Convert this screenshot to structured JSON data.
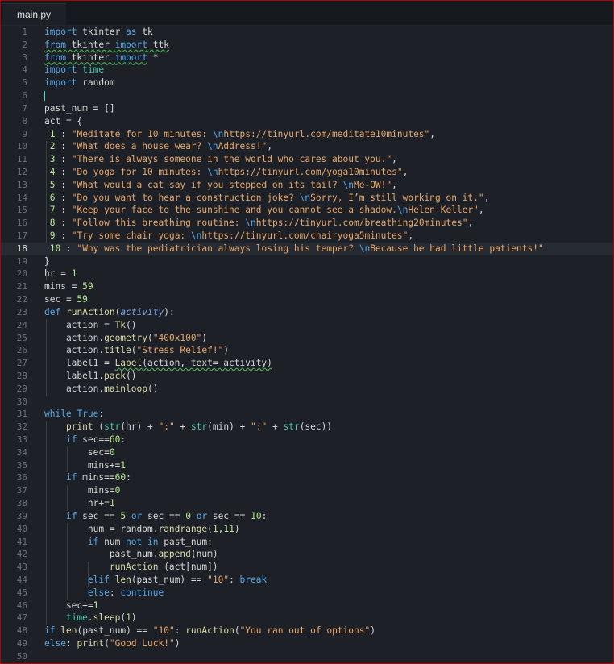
{
  "tab": {
    "filename": "main.py"
  },
  "lines": [
    {
      "n": "1",
      "segs": [
        [
          "kw",
          "import"
        ],
        [
          "op",
          " tkinter "
        ],
        [
          "kw",
          "as"
        ],
        [
          "op",
          " tk"
        ]
      ]
    },
    {
      "n": "2",
      "segs": [
        [
          "kw sq",
          "from"
        ],
        [
          "op sq",
          " tkinter "
        ],
        [
          "kw sq",
          "import"
        ],
        [
          "op sq",
          " ttk"
        ]
      ]
    },
    {
      "n": "3",
      "segs": [
        [
          "kw sq",
          "from"
        ],
        [
          "op sq",
          " tkinter "
        ],
        [
          "kw sq",
          "import"
        ],
        [
          "op",
          " *"
        ]
      ]
    },
    {
      "n": "4",
      "segs": [
        [
          "kw",
          "import"
        ],
        [
          "op",
          " "
        ],
        [
          "bi",
          "time"
        ]
      ]
    },
    {
      "n": "5",
      "segs": [
        [
          "kw",
          "import"
        ],
        [
          "op",
          " random"
        ]
      ]
    },
    {
      "n": "6",
      "segs": [],
      "cursor": true
    },
    {
      "n": "7",
      "segs": [
        [
          "op",
          "past_num = []"
        ]
      ]
    },
    {
      "n": "8",
      "segs": [
        [
          "op",
          "act = {"
        ]
      ]
    },
    {
      "n": "9",
      "segs": [
        [
          "op",
          " "
        ],
        [
          "nm",
          "1"
        ],
        [
          "op",
          " : "
        ],
        [
          "st",
          "\"Meditate for 10 minutes: "
        ],
        [
          "kw",
          "\\n"
        ],
        [
          "st",
          "https://tinyurl.com/meditate10minutes\""
        ],
        [
          "op",
          ","
        ]
      ]
    },
    {
      "n": "10",
      "segs": [
        [
          "op",
          " "
        ],
        [
          "nm",
          "2"
        ],
        [
          "op",
          " : "
        ],
        [
          "st",
          "\"What does a house wear? "
        ],
        [
          "kw",
          "\\n"
        ],
        [
          "st",
          "Address!\""
        ],
        [
          "op",
          ","
        ]
      ]
    },
    {
      "n": "11",
      "segs": [
        [
          "op",
          " "
        ],
        [
          "nm",
          "3"
        ],
        [
          "op",
          " : "
        ],
        [
          "st",
          "\"There is always someone in the world who cares about you.\""
        ],
        [
          "op",
          ","
        ]
      ]
    },
    {
      "n": "12",
      "segs": [
        [
          "op",
          " "
        ],
        [
          "nm",
          "4"
        ],
        [
          "op",
          " : "
        ],
        [
          "st",
          "\"Do yoga for 10 minutes: "
        ],
        [
          "kw",
          "\\n"
        ],
        [
          "st",
          "https://tinyurl.com/yoga10minutes\""
        ],
        [
          "op",
          ","
        ]
      ]
    },
    {
      "n": "13",
      "segs": [
        [
          "op",
          " "
        ],
        [
          "nm",
          "5"
        ],
        [
          "op",
          " : "
        ],
        [
          "st",
          "\"What would a cat say if you stepped on its tail? "
        ],
        [
          "kw",
          "\\n"
        ],
        [
          "st",
          "Me-OW!\""
        ],
        [
          "op",
          ","
        ]
      ]
    },
    {
      "n": "14",
      "segs": [
        [
          "op",
          " "
        ],
        [
          "nm",
          "6"
        ],
        [
          "op",
          " : "
        ],
        [
          "st",
          "\"Do you want to hear a construction joke? "
        ],
        [
          "kw",
          "\\n"
        ],
        [
          "st",
          "Sorry, I’m still working on it.\""
        ],
        [
          "op",
          ","
        ]
      ]
    },
    {
      "n": "15",
      "segs": [
        [
          "op",
          " "
        ],
        [
          "nm",
          "7"
        ],
        [
          "op",
          " : "
        ],
        [
          "st",
          "\"Keep your face to the sunshine and you cannot see a shadow."
        ],
        [
          "kw",
          "\\n"
        ],
        [
          "st",
          "Helen Keller\""
        ],
        [
          "op",
          ","
        ]
      ]
    },
    {
      "n": "16",
      "segs": [
        [
          "op",
          " "
        ],
        [
          "nm",
          "8"
        ],
        [
          "op",
          " : "
        ],
        [
          "st",
          "\"Follow this breathing routine: "
        ],
        [
          "kw",
          "\\n"
        ],
        [
          "st",
          "https://tinyurl.com/breathing20minutes\""
        ],
        [
          "op",
          ","
        ]
      ]
    },
    {
      "n": "17",
      "segs": [
        [
          "op",
          " "
        ],
        [
          "nm",
          "9"
        ],
        [
          "op",
          " : "
        ],
        [
          "st",
          "\"Try some chair yoga: "
        ],
        [
          "kw",
          "\\n"
        ],
        [
          "st",
          "https://tinyurl.com/chairyoga5minutes\""
        ],
        [
          "op",
          ","
        ]
      ]
    },
    {
      "n": "18",
      "segs": [
        [
          "op",
          " "
        ],
        [
          "nm",
          "10"
        ],
        [
          "op",
          " : "
        ],
        [
          "st",
          "\"Why was the pediatrician always losing his temper? "
        ],
        [
          "kw",
          "\\n"
        ],
        [
          "st",
          "Because he had little patients!\""
        ]
      ],
      "active": true
    },
    {
      "n": "19",
      "segs": [
        [
          "op",
          "}"
        ]
      ]
    },
    {
      "n": "20",
      "segs": [
        [
          "op",
          "hr = "
        ],
        [
          "nm",
          "1"
        ]
      ]
    },
    {
      "n": "21",
      "segs": [
        [
          "op",
          "mins = "
        ],
        [
          "nm",
          "59"
        ]
      ]
    },
    {
      "n": "22",
      "segs": [
        [
          "op",
          "sec = "
        ],
        [
          "nm",
          "59"
        ]
      ]
    },
    {
      "n": "23",
      "segs": [
        [
          "kw",
          "def"
        ],
        [
          "op",
          " "
        ],
        [
          "fn",
          "runAction"
        ],
        [
          "op",
          "("
        ],
        [
          "par",
          "activity"
        ],
        [
          "op",
          "):"
        ]
      ]
    },
    {
      "n": "24",
      "segs": [
        [
          "op",
          "    action = "
        ],
        [
          "fn",
          "Tk"
        ],
        [
          "op",
          "()"
        ]
      ]
    },
    {
      "n": "25",
      "segs": [
        [
          "op",
          "    action."
        ],
        [
          "fn",
          "geometry"
        ],
        [
          "op",
          "("
        ],
        [
          "st",
          "\"400x100\""
        ],
        [
          "op",
          ")"
        ]
      ]
    },
    {
      "n": "26",
      "segs": [
        [
          "op",
          "    action."
        ],
        [
          "fn",
          "title"
        ],
        [
          "op",
          "("
        ],
        [
          "st",
          "\"Stress Relief!\""
        ],
        [
          "op",
          ")"
        ]
      ]
    },
    {
      "n": "27",
      "segs": [
        [
          "op",
          "    label1 = "
        ],
        [
          "fn sq",
          "Label"
        ],
        [
          "op sq",
          "(action, text= activity)"
        ]
      ]
    },
    {
      "n": "28",
      "segs": [
        [
          "op",
          "    label1."
        ],
        [
          "fn",
          "pack"
        ],
        [
          "op",
          "()"
        ]
      ]
    },
    {
      "n": "29",
      "segs": [
        [
          "op",
          "    action."
        ],
        [
          "fn",
          "mainloop"
        ],
        [
          "op",
          "()"
        ]
      ]
    },
    {
      "n": "30",
      "segs": []
    },
    {
      "n": "31",
      "segs": [
        [
          "kw",
          "while"
        ],
        [
          "op",
          " "
        ],
        [
          "kw",
          "True"
        ],
        [
          "op",
          ":"
        ]
      ]
    },
    {
      "n": "32",
      "segs": [
        [
          "op",
          "    "
        ],
        [
          "fn",
          "print"
        ],
        [
          "op",
          " ("
        ],
        [
          "bi",
          "str"
        ],
        [
          "op",
          "(hr) + "
        ],
        [
          "st",
          "\":\""
        ],
        [
          "op",
          " + "
        ],
        [
          "bi",
          "str"
        ],
        [
          "op",
          "(min) + "
        ],
        [
          "st",
          "\":\""
        ],
        [
          "op",
          " + "
        ],
        [
          "bi",
          "str"
        ],
        [
          "op",
          "(sec))"
        ]
      ]
    },
    {
      "n": "33",
      "segs": [
        [
          "op",
          "    "
        ],
        [
          "kw",
          "if"
        ],
        [
          "op",
          " sec=="
        ],
        [
          "nm",
          "60"
        ],
        [
          "op",
          ":"
        ]
      ]
    },
    {
      "n": "34",
      "segs": [
        [
          "op",
          "        sec="
        ],
        [
          "nm",
          "0"
        ]
      ]
    },
    {
      "n": "35",
      "segs": [
        [
          "op",
          "        mins+="
        ],
        [
          "nm",
          "1"
        ]
      ]
    },
    {
      "n": "36",
      "segs": [
        [
          "op",
          "    "
        ],
        [
          "kw",
          "if"
        ],
        [
          "op",
          " mins=="
        ],
        [
          "nm",
          "60"
        ],
        [
          "op",
          ":"
        ]
      ]
    },
    {
      "n": "37",
      "segs": [
        [
          "op",
          "        mins="
        ],
        [
          "nm",
          "0"
        ]
      ]
    },
    {
      "n": "38",
      "segs": [
        [
          "op",
          "        hr+="
        ],
        [
          "nm",
          "1"
        ]
      ]
    },
    {
      "n": "39",
      "segs": [
        [
          "op",
          "    "
        ],
        [
          "kw",
          "if"
        ],
        [
          "op",
          " sec == "
        ],
        [
          "nm",
          "5"
        ],
        [
          "op",
          " "
        ],
        [
          "kw",
          "or"
        ],
        [
          "op",
          " sec == "
        ],
        [
          "nm",
          "0"
        ],
        [
          "op",
          " "
        ],
        [
          "kw",
          "or"
        ],
        [
          "op",
          " sec == "
        ],
        [
          "nm",
          "10"
        ],
        [
          "op",
          ":"
        ]
      ]
    },
    {
      "n": "40",
      "segs": [
        [
          "op",
          "        num = random."
        ],
        [
          "fn",
          "randrange"
        ],
        [
          "op",
          "("
        ],
        [
          "nm",
          "1"
        ],
        [
          "op",
          ","
        ],
        [
          "nm",
          "11"
        ],
        [
          "op",
          ")"
        ]
      ]
    },
    {
      "n": "41",
      "segs": [
        [
          "op",
          "        "
        ],
        [
          "kw",
          "if"
        ],
        [
          "op",
          " num "
        ],
        [
          "kw",
          "not in"
        ],
        [
          "op",
          " past_num:"
        ]
      ]
    },
    {
      "n": "42",
      "segs": [
        [
          "op",
          "            past_num."
        ],
        [
          "fn",
          "append"
        ],
        [
          "op",
          "(num)"
        ]
      ]
    },
    {
      "n": "43",
      "segs": [
        [
          "op",
          "            "
        ],
        [
          "fn",
          "runAction"
        ],
        [
          "op",
          " (act[num])"
        ]
      ]
    },
    {
      "n": "44",
      "segs": [
        [
          "op",
          "        "
        ],
        [
          "kw",
          "elif"
        ],
        [
          "op",
          " "
        ],
        [
          "fn",
          "len"
        ],
        [
          "op",
          "(past_num) == "
        ],
        [
          "st",
          "\"10\""
        ],
        [
          "op",
          ": "
        ],
        [
          "kw",
          "break"
        ]
      ]
    },
    {
      "n": "45",
      "segs": [
        [
          "op",
          "        "
        ],
        [
          "kw",
          "else"
        ],
        [
          "op",
          ": "
        ],
        [
          "kw",
          "continue"
        ]
      ]
    },
    {
      "n": "46",
      "segs": [
        [
          "op",
          "    sec+="
        ],
        [
          "nm",
          "1"
        ]
      ]
    },
    {
      "n": "47",
      "segs": [
        [
          "op",
          "    "
        ],
        [
          "bi",
          "time"
        ],
        [
          "op",
          "."
        ],
        [
          "fn",
          "sleep"
        ],
        [
          "op",
          "("
        ],
        [
          "nm",
          "1"
        ],
        [
          "op",
          ")"
        ]
      ]
    },
    {
      "n": "48",
      "segs": [
        [
          "kw",
          "if"
        ],
        [
          "op",
          " "
        ],
        [
          "fn",
          "len"
        ],
        [
          "op",
          "(past_num) == "
        ],
        [
          "st",
          "\"10\""
        ],
        [
          "op",
          ": "
        ],
        [
          "fn",
          "runAction"
        ],
        [
          "op",
          "("
        ],
        [
          "st",
          "\"You ran out of options\""
        ],
        [
          "op",
          ")"
        ]
      ]
    },
    {
      "n": "49",
      "segs": [
        [
          "kw",
          "else"
        ],
        [
          "op",
          ": "
        ],
        [
          "fn",
          "print"
        ],
        [
          "op",
          "("
        ],
        [
          "st",
          "\"Good Luck!\""
        ],
        [
          "op",
          ")"
        ]
      ]
    },
    {
      "n": "50",
      "segs": []
    }
  ]
}
